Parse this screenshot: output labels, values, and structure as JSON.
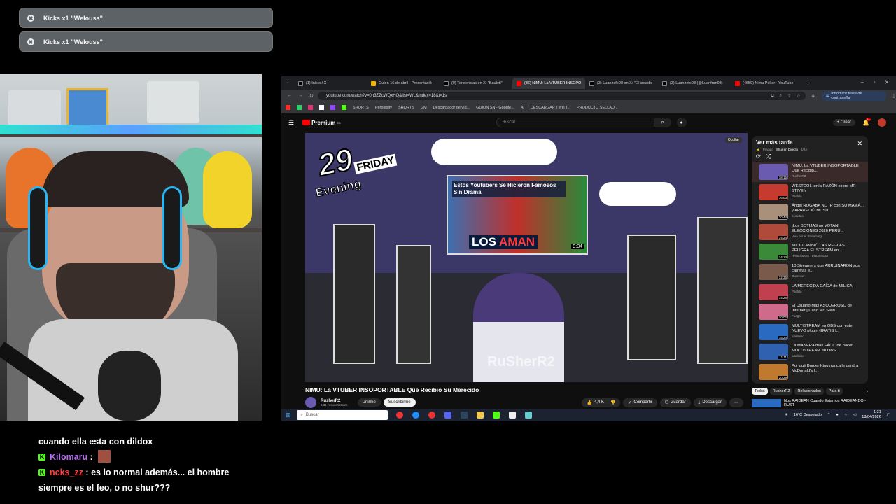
{
  "notifications": [
    {
      "prefix": "Kicks x1 ",
      "name": "\"Welouss\""
    },
    {
      "prefix": "Kicks x1 ",
      "name": "\"Welouss\""
    }
  ],
  "chat": {
    "line0": "cuando ella esta con dildox",
    "messages": [
      {
        "user": "Kilomaru",
        "sep": " :",
        "text": "",
        "user_color": "#b56cf0"
      },
      {
        "user": "ncks_zz",
        "sep": " :",
        "text": " es lo normal además... el hombre siempre es el feo, o no shur???",
        "user_color": "#ff3b3b"
      }
    ]
  },
  "browser": {
    "tabs": [
      "(1) Inicio / X",
      "Guion 16 de abril - Presentació",
      "(9) Tendencias en X: \"Bauleti\"",
      "(36) NIMU: La VTUBER INSOPO",
      "(3) Luanzefe98 en X: \"El creado",
      "(3) Luanzefe98 (@Luanfran98)",
      "(4659) Nimu Poker - YouTube"
    ],
    "url": "youtube.com/watch?v=0h3ZZcWQxHQ&list=WL&index=18&t=1s",
    "password_btn": "Introducir frase de contraseña",
    "bookmarks": [
      "SHORTS",
      "Perplexity",
      "SHORTS",
      "GM",
      "Descargador de víd...",
      "GUION SN - Google...",
      "AI",
      "DESCARGAR TWITT...",
      "PRODUCTO SELLAD..."
    ]
  },
  "youtube": {
    "logo": "Premium",
    "logo_sup": "ES",
    "search_placeholder": "Buscar",
    "create": "Crear",
    "notif_count": "9+",
    "hide_btn": "Ocultar",
    "video_title": "NIMU: La VTUBER INSOPORTABLE Que Recibió Su Merecido",
    "channel": "RusherR2",
    "subs": "5,31 K suscriptores",
    "join": "Unirme",
    "subscribe": "Suscribirme",
    "likes": "4,4 K",
    "share": "Compartir",
    "save": "Guardar",
    "download": "Descargar",
    "overlay": {
      "day": "29",
      "weekday": "FRIDAY",
      "time": "Evening",
      "watermark": "RuSherR2"
    },
    "card": {
      "title": "Estos Youtubers Se Hicieron Famosos Sin Drama",
      "banner_a": "LOS ",
      "banner_b": "AMAN",
      "duration": "9:34"
    }
  },
  "playlist": {
    "title": "Ver más tarde",
    "meta": "Privado",
    "owner": "Shur en Directo",
    "position": "1/24",
    "items": [
      {
        "title": "NIMU: La VTUBER INSOPORTABLE Que Recibió...",
        "channel": "RusherR2",
        "dur": "18:16",
        "color": "#6a5ab0"
      },
      {
        "title": "WESTCOL tenía RAZÓN sobre MR STIVEN",
        "channel": "Pastilla",
        "dur": "16:03",
        "color": "#c63a2f"
      },
      {
        "title": "Ángel ROGABA NO IR con SU MAMÁ... y APARECIÓ MUSIT...",
        "channel": "zostidea",
        "dur": "20:44",
        "color": "#a8907a"
      },
      {
        "title": "¡Los BOTIJAS no VOTAN! ELECCIONES 2026 PERÚ...",
        "channel": "Vivo por el Streaming",
        "dur": "14:24",
        "color": "#b04a3a"
      },
      {
        "title": "KICK CAMBIÓ LAS REGLAS... PELIGRA EL STREAM en...",
        "channel": "HABLAMOS TENDENCIA",
        "dur": "14:13",
        "color": "#3a8a3a"
      },
      {
        "title": "10 Streamers que ARRUINARON sus carreras e...",
        "channel": "Ourenser",
        "dur": "12:36",
        "color": "#7a5a4a"
      },
      {
        "title": "LA MERECIDA CAÍDA de MILICA",
        "channel": "Pastilla",
        "dur": "14:26",
        "color": "#c04050"
      },
      {
        "title": "El Usuario Más ASQUEROSO de Internet | Caso Mr. Swirl",
        "channel": "Fuego",
        "dur": "20:02",
        "color": "#d06a8a"
      },
      {
        "title": "MULTISTREAM en OBS con este NUEVO plugin GRATIS |...",
        "channel": "juanluisd",
        "dur": "15:24",
        "color": "#2a6ac0"
      },
      {
        "title": "La MANERA más FÁCIL de hacer MULTISTREAM en OBS...",
        "channel": "juanluisd",
        "dur": "11:11",
        "color": "#3060b0"
      },
      {
        "title": "Por qué Burger King nunca le ganó a McDonald's |...",
        "channel": "",
        "dur": "20:29",
        "color": "#c07a30"
      }
    ]
  },
  "chips": [
    "Todos",
    "RusherR2",
    "Relacionados",
    "Para ti"
  ],
  "next_video": "Nos RAIDEAN Cuando Estamos RAIDEANDO - RUST",
  "taskbar": {
    "search": "Buscar",
    "weather": "16°C  Despejado",
    "time": "1:31",
    "date": "18/04/2026"
  }
}
